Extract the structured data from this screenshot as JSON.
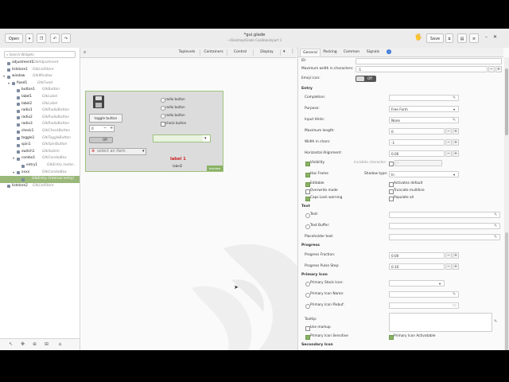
{
  "header": {
    "open_label": "Open",
    "title": "*gui.glade",
    "subtitle": "~/Desktop/Glade Cookbook/part 1",
    "save_label": "Save"
  },
  "widgets_panel": {
    "search_placeholder": "Search Widgets",
    "tree": [
      {
        "name": "adjustment1",
        "type": "GtkAdjustment"
      },
      {
        "name": "liststore1",
        "type": "GtkListStore"
      },
      {
        "name": "window",
        "type": "GtkWindow"
      },
      {
        "name": "fixed1",
        "type": "GtkFixed"
      },
      {
        "name": "button1",
        "type": "GtkButton"
      },
      {
        "name": "label1",
        "type": "GtkLabel"
      },
      {
        "name": "label2",
        "type": "GtkLabel"
      },
      {
        "name": "radio1",
        "type": "GtkRadioButton"
      },
      {
        "name": "radio2",
        "type": "GtkRadioButton"
      },
      {
        "name": "radio3",
        "type": "GtkRadioButton"
      },
      {
        "name": "check1",
        "type": "GtkCheckButton"
      },
      {
        "name": "toggle1",
        "type": "GtkToggleButton"
      },
      {
        "name": "spin1",
        "type": "GtkSpinButton"
      },
      {
        "name": "switch1",
        "type": "GtkSwitch"
      },
      {
        "name": "combo1",
        "type": "GtkComboBox"
      },
      {
        "name": "entry1",
        "type": "GtkEntry (exter..."
      },
      {
        "name": "xxxx",
        "type": "GtkComboBox"
      },
      {
        "name": "",
        "type": "GtkEntry  (internal entry)"
      },
      {
        "name": "liststore2",
        "type": "GtkListStore"
      }
    ]
  },
  "design": {
    "tabs": [
      "Toplevels",
      "Containers",
      "Control",
      "Display"
    ],
    "form": {
      "toggle_button": "toggle button",
      "radio1": "radio button",
      "radio2": "radio button",
      "radio3": "radio button",
      "check": "check button",
      "spin_value": "0",
      "switch_label": "Off",
      "combo_placeholder": "select an item",
      "label1": "label 1",
      "label2": "label2",
      "window_tag": "window"
    }
  },
  "properties": {
    "tabs": [
      "General",
      "Packing",
      "Common",
      "Signals"
    ],
    "id_label": "ID:",
    "max_width_label": "Maximum width in characters:",
    "max_width_value": "-1",
    "emoji_label": "Emoji icon:",
    "emoji_switch": "Off",
    "entry_section": "Entry",
    "completion_label": "Completion:",
    "purpose_label": "Purpose:",
    "purpose_value": "Free Form",
    "input_hints_label": "Input Hints:",
    "input_hints_value": "None",
    "max_length_label": "Maximum length:",
    "max_length_value": "0",
    "width_chars_label": "Width in chars:",
    "width_chars_value": "-1",
    "h_align_label": "Horizontal Alignment:",
    "h_align_value": "0.00",
    "visibility_label": "Visibility",
    "invisible_char_label": "Invisible character:",
    "invisible_char_value": "*",
    "has_frame_label": "Has Frame",
    "shadow_type_label": "Shadow type:",
    "shadow_type_value": "In",
    "editable_label": "Editable",
    "activates_default_label": "Activates default",
    "overwrite_label": "Overwrite mode",
    "truncate_label": "Truncate multiline",
    "caps_label": "Caps Lock warning",
    "populate_label": "Populate all",
    "text_section": "Text",
    "text_label": "Text:",
    "text_buffer_label": "Text Buffer:",
    "placeholder_label": "Placeholder text:",
    "progress_section": "Progress",
    "progress_fraction_label": "Progress Fraction:",
    "progress_fraction_value": "0.00",
    "progress_pulse_label": "Progress Pulse Step:",
    "progress_pulse_value": "0.10",
    "primary_icon_section": "Primary Icon",
    "primary_stock_label": "Primary Stock Icon:",
    "primary_icon_name_label": "Primary Icon Name:",
    "primary_pixbuf_label": "Primary Icon Pixbuf:",
    "tooltip_label": "Tooltip:",
    "use_markup_label": "Use markup",
    "primary_sensitive_label": "Primary Icon Sensitive",
    "primary_activatable_label": "Primary Icon Activatable",
    "secondary_icon_section": "Secondary Icon"
  },
  "colors": {
    "accent": "#8ab266",
    "label_red": "#cc2222"
  }
}
